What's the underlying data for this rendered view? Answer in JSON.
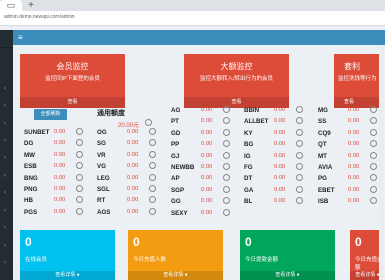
{
  "browser": {
    "tab_icon": "folder-icon",
    "new_tab": "+",
    "url": "admin.demo.newapi.com/admin"
  },
  "header": {
    "menu_icon": "≡"
  },
  "panels": [
    {
      "title": "会员监控",
      "sub": "监控同IP下面登的会员",
      "foot": "查看"
    },
    {
      "title": "大额监控",
      "sub": "监控大额转入/转出行为的会员",
      "foot": "查看"
    },
    {
      "title": "套利",
      "sub": "监控洗钱等行为",
      "foot": "查看"
    }
  ],
  "balances": {
    "refresh_label": "全部刷新",
    "total_label": "通用额度",
    "total_value": "20.00元",
    "columns": [
      [
        {
          "name": "SUNBET",
          "value": "0.00"
        },
        {
          "name": "DG",
          "value": "0.00"
        },
        {
          "name": "MW",
          "value": "0.00"
        },
        {
          "name": "ESB",
          "value": "0.00"
        },
        {
          "name": "BNG",
          "value": "0.00"
        },
        {
          "name": "PNG",
          "value": "0.00"
        },
        {
          "name": "HB",
          "value": "0.00"
        },
        {
          "name": "PGS",
          "value": "0.00"
        }
      ],
      [
        {
          "name": "OG",
          "value": "0.00"
        },
        {
          "name": "SG",
          "value": "0.00"
        },
        {
          "name": "VR",
          "value": "0.00"
        },
        {
          "name": "VG",
          "value": "0.00"
        },
        {
          "name": "LEG",
          "value": "0.00"
        },
        {
          "name": "SGL",
          "value": "0.00"
        },
        {
          "name": "RT",
          "value": "0.00"
        },
        {
          "name": "AGS",
          "value": "0.00"
        }
      ],
      [
        {
          "name": "AG",
          "value": "0.00"
        },
        {
          "name": "PT",
          "value": "0.00"
        },
        {
          "name": "GD",
          "value": "0.00"
        },
        {
          "name": "PP",
          "value": "0.00"
        },
        {
          "name": "GJ",
          "value": "0.00"
        },
        {
          "name": "NEWBB",
          "value": "0.00"
        },
        {
          "name": "AP",
          "value": "0.00"
        },
        {
          "name": "SGP",
          "value": "0.00"
        },
        {
          "name": "GG",
          "value": "0.00"
        },
        {
          "name": "SEXY",
          "value": "0.00"
        }
      ],
      [
        {
          "name": "BBIN",
          "value": "0.00"
        },
        {
          "name": "ALLBET",
          "value": "0.00"
        },
        {
          "name": "KY",
          "value": "0.00"
        },
        {
          "name": "BG",
          "value": "0.00"
        },
        {
          "name": "IG",
          "value": "0.00"
        },
        {
          "name": "FG",
          "value": "0.00"
        },
        {
          "name": "DT",
          "value": "0.00"
        },
        {
          "name": "GA",
          "value": "0.00"
        },
        {
          "name": "BL",
          "value": "0.00"
        }
      ],
      [
        {
          "name": "MG",
          "value": "0.00"
        },
        {
          "name": "SS",
          "value": "0.00"
        },
        {
          "name": "CQ9",
          "value": "0.00"
        },
        {
          "name": "QT",
          "value": "0.00"
        },
        {
          "name": "MT",
          "value": "0.00"
        },
        {
          "name": "AVIA",
          "value": "0.00"
        },
        {
          "name": "PG",
          "value": "0.00"
        },
        {
          "name": "EBET",
          "value": "0.00"
        },
        {
          "name": "ISB",
          "value": "0.00"
        }
      ]
    ]
  },
  "stats": [
    {
      "num": "0",
      "label": "在线会员",
      "foot": "查看详情 ●",
      "color": "#00c0ef"
    },
    {
      "num": "0",
      "label": "今日充值人数",
      "foot": "查看详情 ●",
      "color": "#f39c12"
    },
    {
      "num": "0",
      "label": "今日提款金额",
      "foot": "查看详情 ●",
      "color": "#00a65a"
    },
    {
      "num": "0",
      "label": "今日充值金额",
      "foot": "查看详情 ●",
      "color": "#dd4b39"
    }
  ]
}
